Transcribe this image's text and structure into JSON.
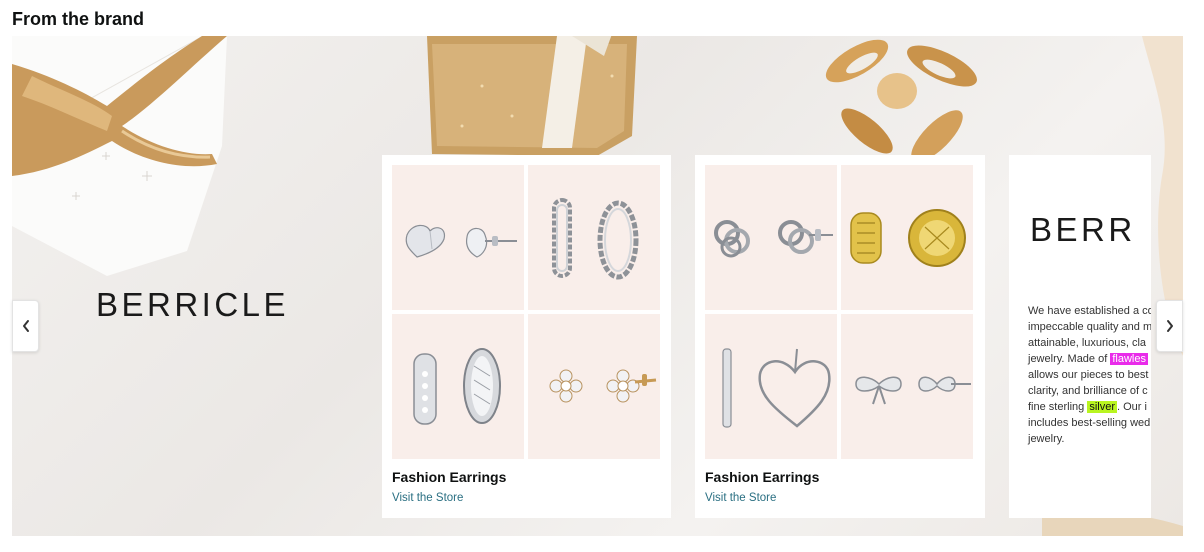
{
  "section": {
    "title": "From the brand"
  },
  "brand": {
    "logo_text": "BERRICLE",
    "logo_partial": "BERR"
  },
  "cards": [
    {
      "title": "Fashion Earrings",
      "link": "Visit the Store"
    },
    {
      "title": "Fashion Earrings",
      "link": "Visit the Store"
    }
  ],
  "about": {
    "line1": "We have established a co",
    "line2": "impeccable quality and m",
    "line3": "attainable, luxurious, cla",
    "line4_pre": "jewelry. Made of ",
    "line4_hl": "flawles",
    "line5": "allows our pieces to best",
    "line6": "clarity, and brilliance of c",
    "line7_pre": "fine sterling ",
    "line7_hl": "silver",
    "line7_post": ". Our i",
    "line8": "includes best-selling wed",
    "line9": "jewelry."
  },
  "nav": {
    "prev_icon": "chevron-left-icon",
    "next_icon": "chevron-right-icon"
  },
  "colors": {
    "tile_bg": "#f9eeea",
    "link": "#2a6f82",
    "highlight_magenta": "#e92bea",
    "highlight_green": "#b9f520",
    "gold": "#c9a063"
  }
}
